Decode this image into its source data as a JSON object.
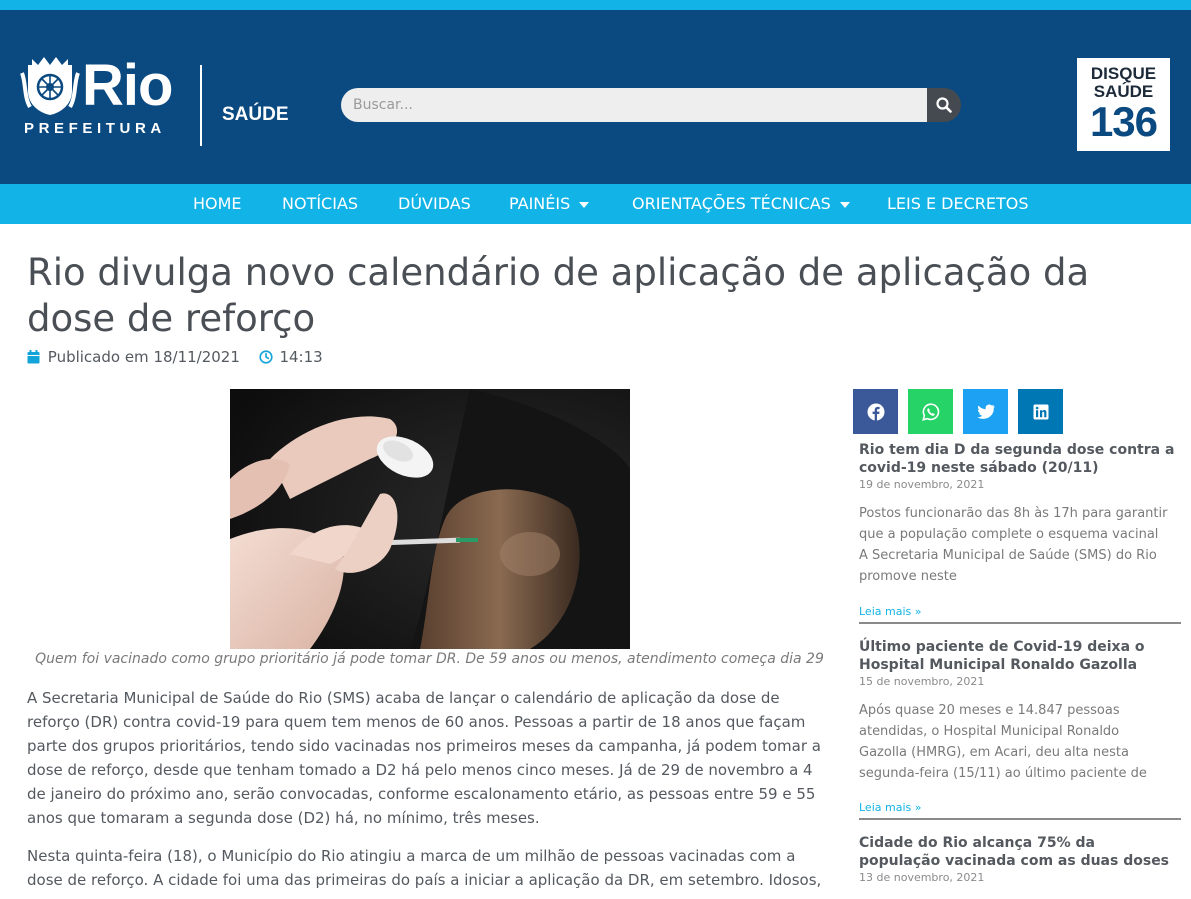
{
  "header": {
    "brand_word": "Rio",
    "brand_sub": "PREFEITURA",
    "section": "SAÚDE",
    "search_placeholder": "Buscar...",
    "hotline": {
      "line1": "DISQUE",
      "line2": "SAÚDE",
      "number": "136"
    }
  },
  "nav": {
    "items": [
      {
        "label": "HOME",
        "has_dropdown": false
      },
      {
        "label": "NOTÍCIAS",
        "has_dropdown": false
      },
      {
        "label": "DÚVIDAS",
        "has_dropdown": false
      },
      {
        "label": "PAINÉIS",
        "has_dropdown": true
      },
      {
        "label": "ORIENTAÇÕES TÉCNICAS",
        "has_dropdown": true
      },
      {
        "label": "LEIS E DECRETOS",
        "has_dropdown": false
      }
    ]
  },
  "article": {
    "title": "Rio divulga novo calendário de aplicação de aplicação da dose de reforço",
    "published": "Publicado em 18/11/2021",
    "time": "14:13",
    "caption": "Quem foi vacinado como grupo prioritário já pode tomar DR. De 59 anos ou menos, atendimento começa dia 29",
    "paragraphs": [
      "A Secretaria Municipal de Saúde do Rio (SMS) acaba de lançar o calendário de aplicação da dose de reforço (DR) contra covid-19 para quem tem menos de 60 anos. Pessoas a partir de 18 anos que façam parte dos grupos prioritários, tendo sido vacinadas nos primeiros meses da campanha, já podem tomar a dose de reforço, desde que tenham tomado a D2 há pelo menos cinco meses. Já de 29 de novembro a 4 de janeiro do próximo ano, serão convocadas, conforme escalonamento etário, as pessoas entre 59 e 55 anos que tomaram a segunda dose (D2) há, no mínimo, três meses.",
      "Nesta quinta-feira (18), o Município do Rio atingiu a marca de um milhão de pessoas vacinadas com a dose de reforço. A cidade foi uma das primeiras do país a iniciar a aplicação da DR, em setembro. Idosos, pessoas com"
    ]
  },
  "share": [
    {
      "network": "facebook",
      "color": "#3b5998"
    },
    {
      "network": "whatsapp",
      "color": "#25d366"
    },
    {
      "network": "twitter",
      "color": "#1da1f2"
    },
    {
      "network": "linkedin",
      "color": "#0077b5"
    }
  ],
  "sidebar": {
    "posts": [
      {
        "title": "Rio tem dia D da segunda dose contra a covid-19 neste sábado (20/11)",
        "date": "19 de novembro, 2021",
        "excerpt": "Postos funcionarão das 8h às 17h para garantir que a população complete o esquema vacinal A Secretaria Municipal de Saúde (SMS) do Rio promove neste",
        "more": "Leia mais »"
      },
      {
        "title": "Último paciente de Covid-19 deixa o Hospital Municipal Ronaldo Gazolla",
        "date": "15 de novembro, 2021",
        "excerpt": "Após quase 20 meses e 14.847 pessoas atendidas, o Hospital Municipal Ronaldo Gazolla (HMRG), em Acari, deu alta nesta segunda-feira (15/11) ao último paciente de",
        "more": "Leia mais »"
      },
      {
        "title": "Cidade do Rio alcança 75% da população vacinada com as duas doses",
        "date": "13 de novembro, 2021"
      }
    ]
  },
  "colors": {
    "header_bg": "#0b4a80",
    "accent": "#12b3e6",
    "text": "#54595f"
  }
}
